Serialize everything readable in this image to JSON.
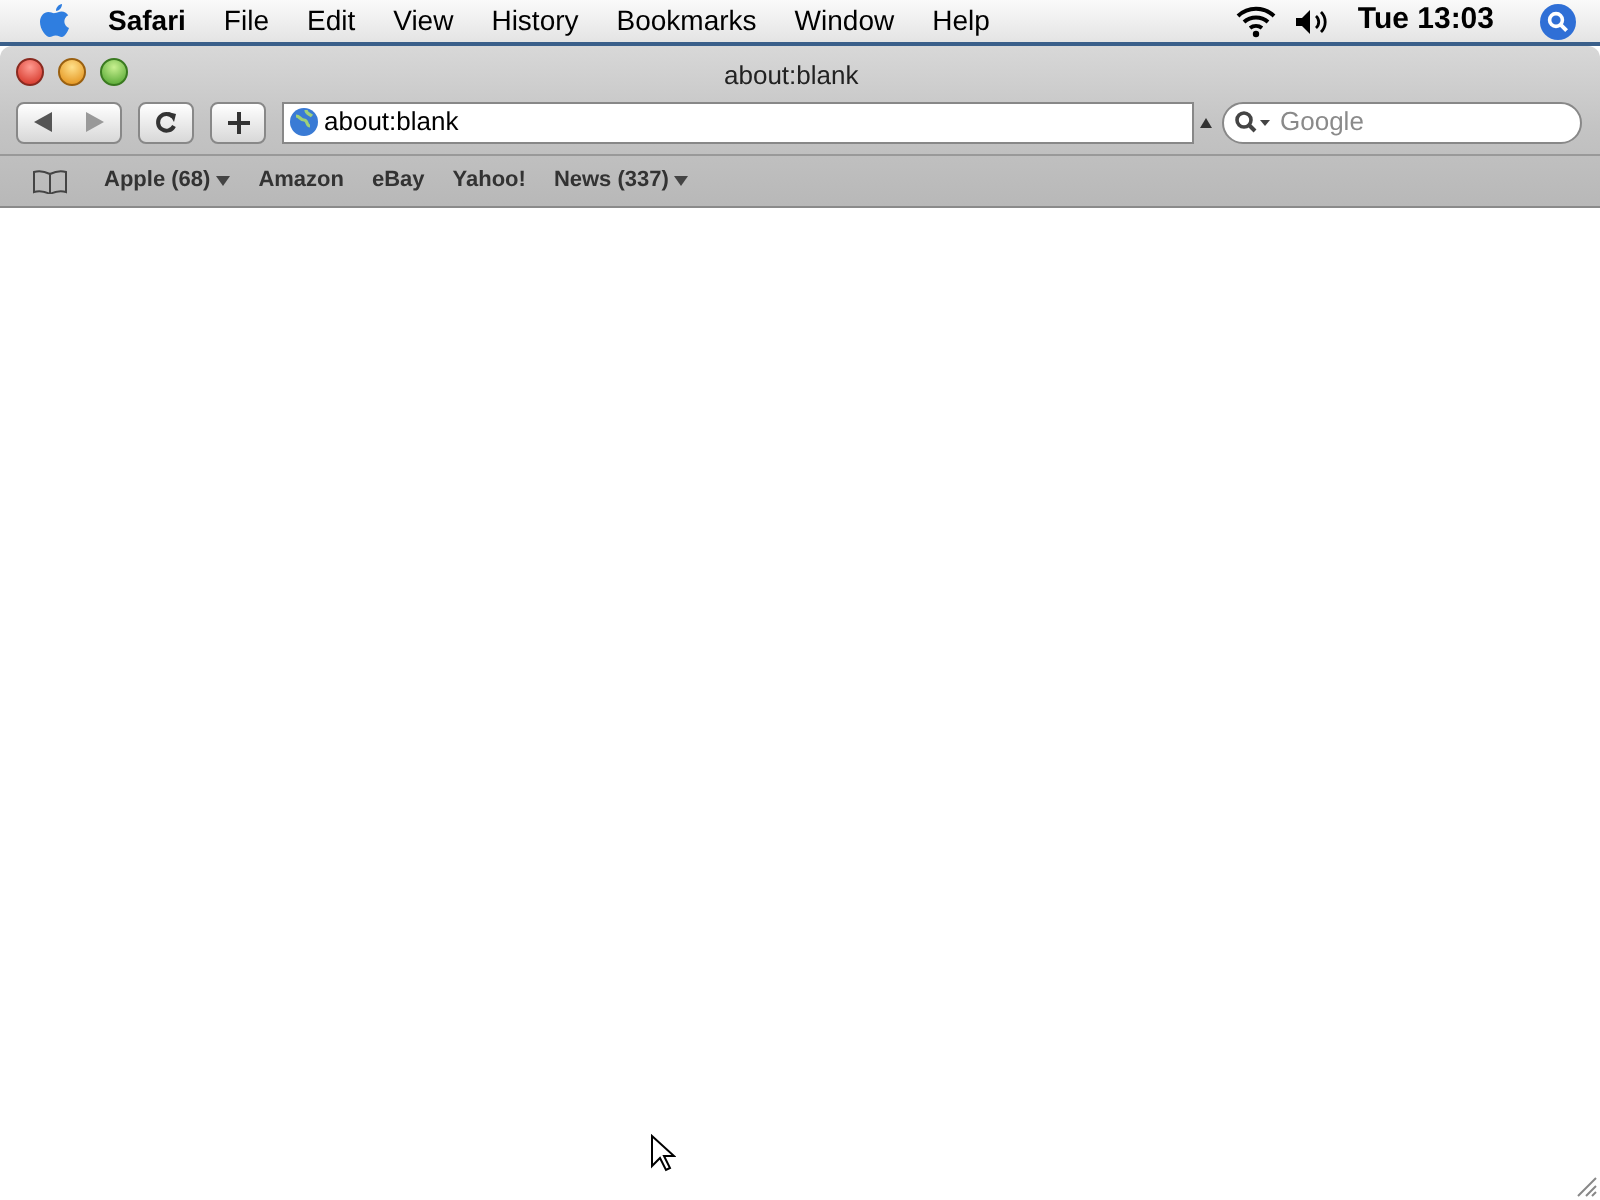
{
  "menu_bar": {
    "items": [
      {
        "label": "Safari",
        "kind": "app"
      },
      {
        "label": "File",
        "kind": "menu"
      },
      {
        "label": "Edit",
        "kind": "menu"
      },
      {
        "label": "View",
        "kind": "menu"
      },
      {
        "label": "History",
        "kind": "menu"
      },
      {
        "label": "Bookmarks",
        "kind": "menu"
      },
      {
        "label": "Window",
        "kind": "menu"
      },
      {
        "label": "Help",
        "kind": "menu"
      }
    ],
    "clock": "Tue 13:03"
  },
  "window": {
    "title": "about:blank"
  },
  "toolbar": {
    "address": "about:blank",
    "search_placeholder": "Google"
  },
  "bookmarks": [
    {
      "label": "Apple (68)",
      "has_menu": true
    },
    {
      "label": "Amazon",
      "has_menu": false
    },
    {
      "label": "eBay",
      "has_menu": false
    },
    {
      "label": "Yahoo!",
      "has_menu": false
    },
    {
      "label": "News (337)",
      "has_menu": true
    }
  ]
}
